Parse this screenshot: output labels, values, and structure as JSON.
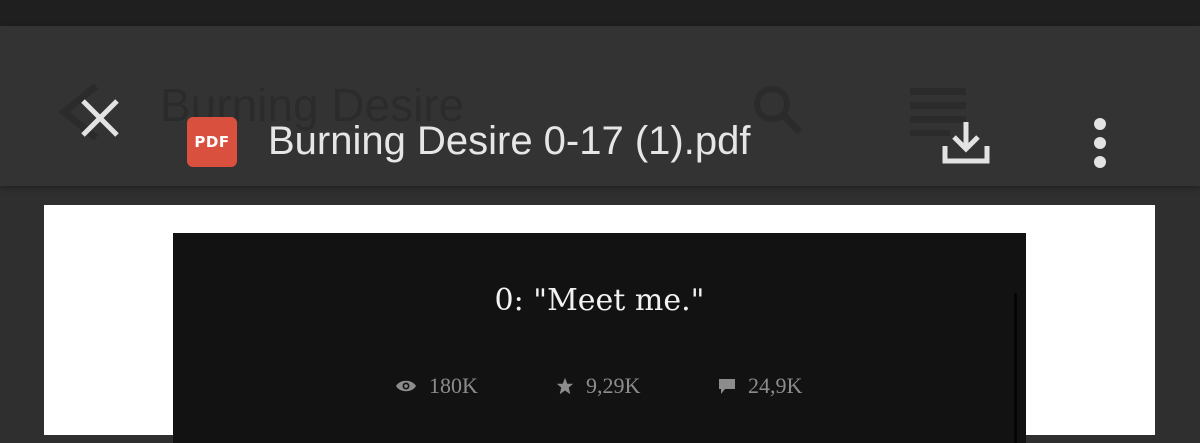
{
  "app_bar": {
    "file_title": "Burning Desire 0-17 (1).pdf",
    "badge_label": "PDF",
    "background_title": "Burning Desire",
    "close_icon": "close-icon",
    "download_icon": "download-icon",
    "menu_icon": "more-vert-icon"
  },
  "document": {
    "chapter_title": "0: \"Meet me.\"",
    "stats": {
      "views": "180K",
      "votes": "9,29K",
      "comments": "24,9K"
    }
  },
  "colors": {
    "app_bar": "#333333",
    "pdf_badge": "#d9503f",
    "page": "#ffffff",
    "page_image": "#121212"
  }
}
